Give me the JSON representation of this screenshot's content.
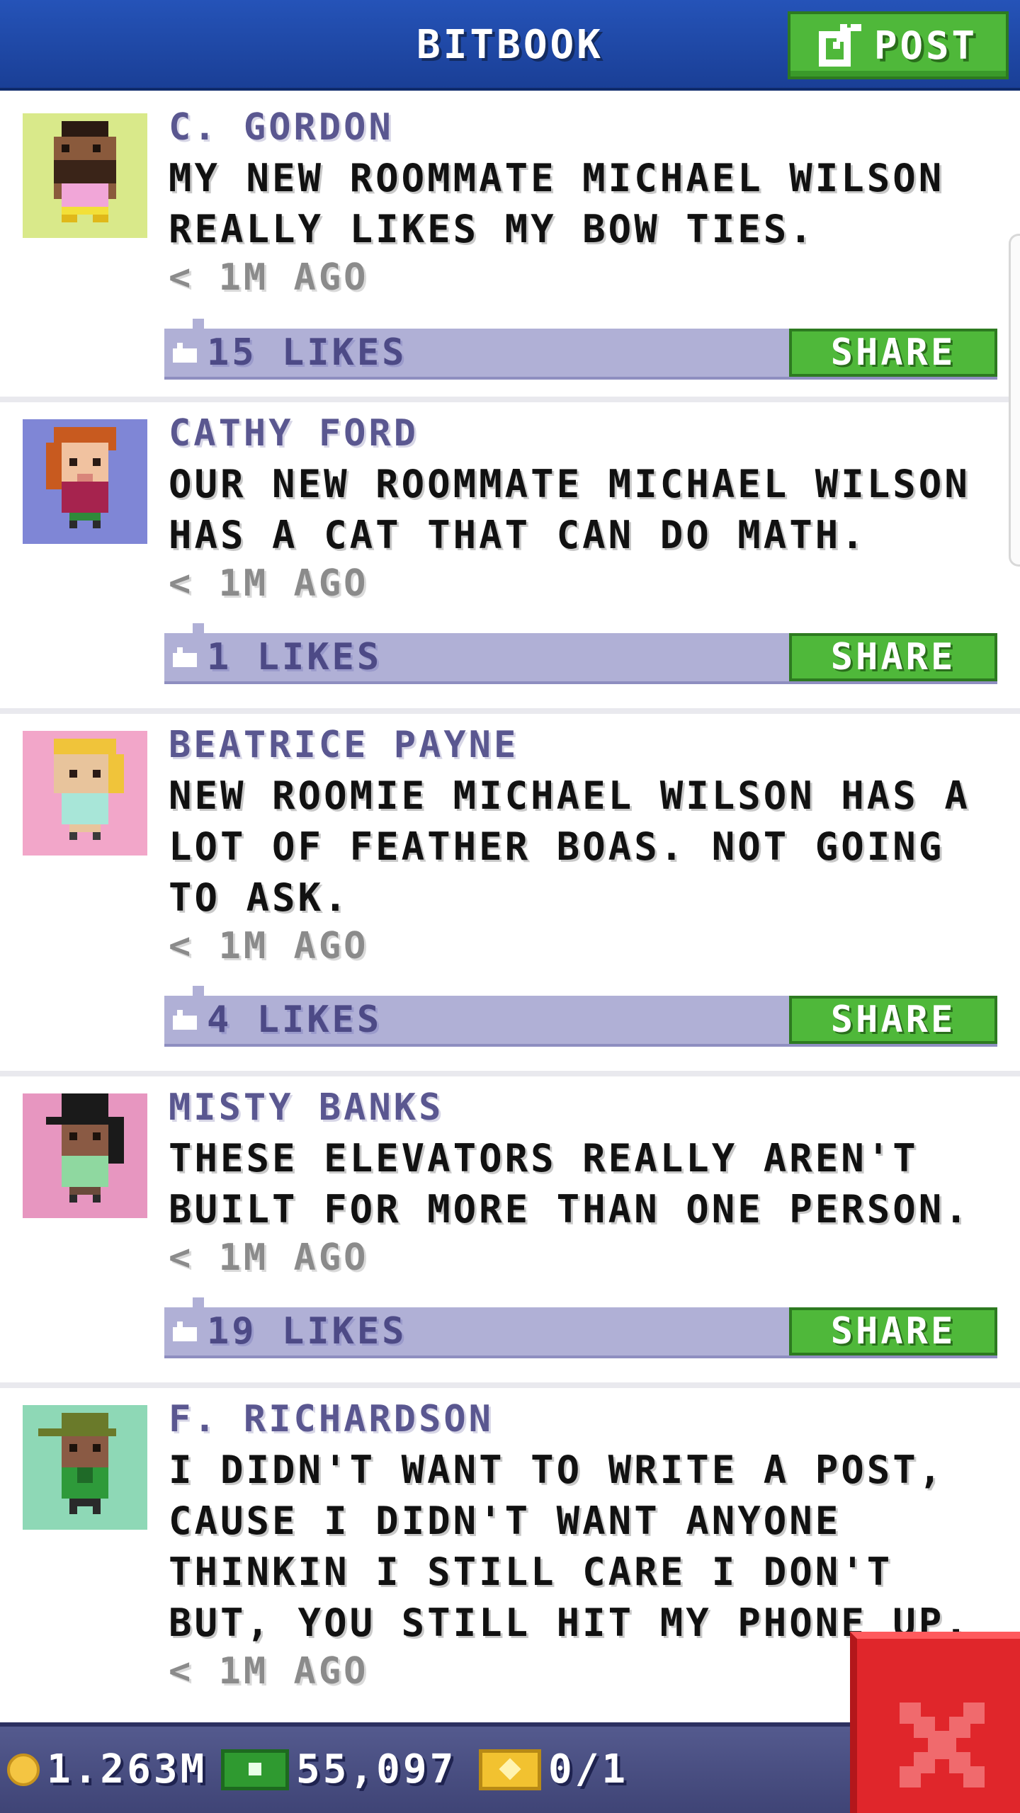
{
  "header": {
    "title": "BITBOOK",
    "post_label": "POST"
  },
  "share_label": "SHARE",
  "posts": [
    {
      "author": "C. GORDON",
      "text": "MY NEW ROOMMATE MICHAEL WILSON REALLY LIKES MY BOW TIES.",
      "time": "< 1M AGO",
      "likes": "15 LIKES",
      "avatar_bg": "#d9e98a"
    },
    {
      "author": "CATHY FORD",
      "text": "OUR NEW ROOMMATE MICHAEL WILSON HAS A CAT THAT CAN DO MATH.",
      "time": "< 1M AGO",
      "likes": "1 LIKES",
      "avatar_bg": "#7f86d6"
    },
    {
      "author": "BEATRICE PAYNE",
      "text": "NEW ROOMIE MICHAEL WILSON HAS A LOT OF FEATHER BOAS. NOT GOING TO ASK.",
      "time": "< 1M AGO",
      "likes": "4 LIKES",
      "avatar_bg": "#f2a6c9"
    },
    {
      "author": "MISTY BANKS",
      "text": "THESE ELEVATORS REALLY AREN'T BUILT FOR MORE THAN ONE PERSON.",
      "time": "< 1M AGO",
      "likes": "19 LIKES",
      "avatar_bg": "#e796c0"
    },
    {
      "author": "F. RICHARDSON",
      "text": "I DIDN'T WANT TO WRITE A POST, CAUSE I DIDN'T WANT ANYONE THINKIN I STILL CARE I DON'T BUT, YOU STILL HIT MY PHONE UP.",
      "time": "< 1M AGO",
      "likes": "",
      "avatar_bg": "#8ed8b6"
    }
  ],
  "status": {
    "coins": "1.263M",
    "bux": "55,097",
    "tickets": "0/1"
  },
  "colors": {
    "header": "#2553b8",
    "accent_green": "#4fb83a",
    "like_bar": "#b0b0d6",
    "close": "#e0262b"
  },
  "icons": {
    "post": "edit-icon",
    "like": "thumbs-up-icon",
    "close": "close-icon",
    "coin": "coin-icon",
    "cash": "bux-icon",
    "ticket": "golden-ticket-icon"
  }
}
